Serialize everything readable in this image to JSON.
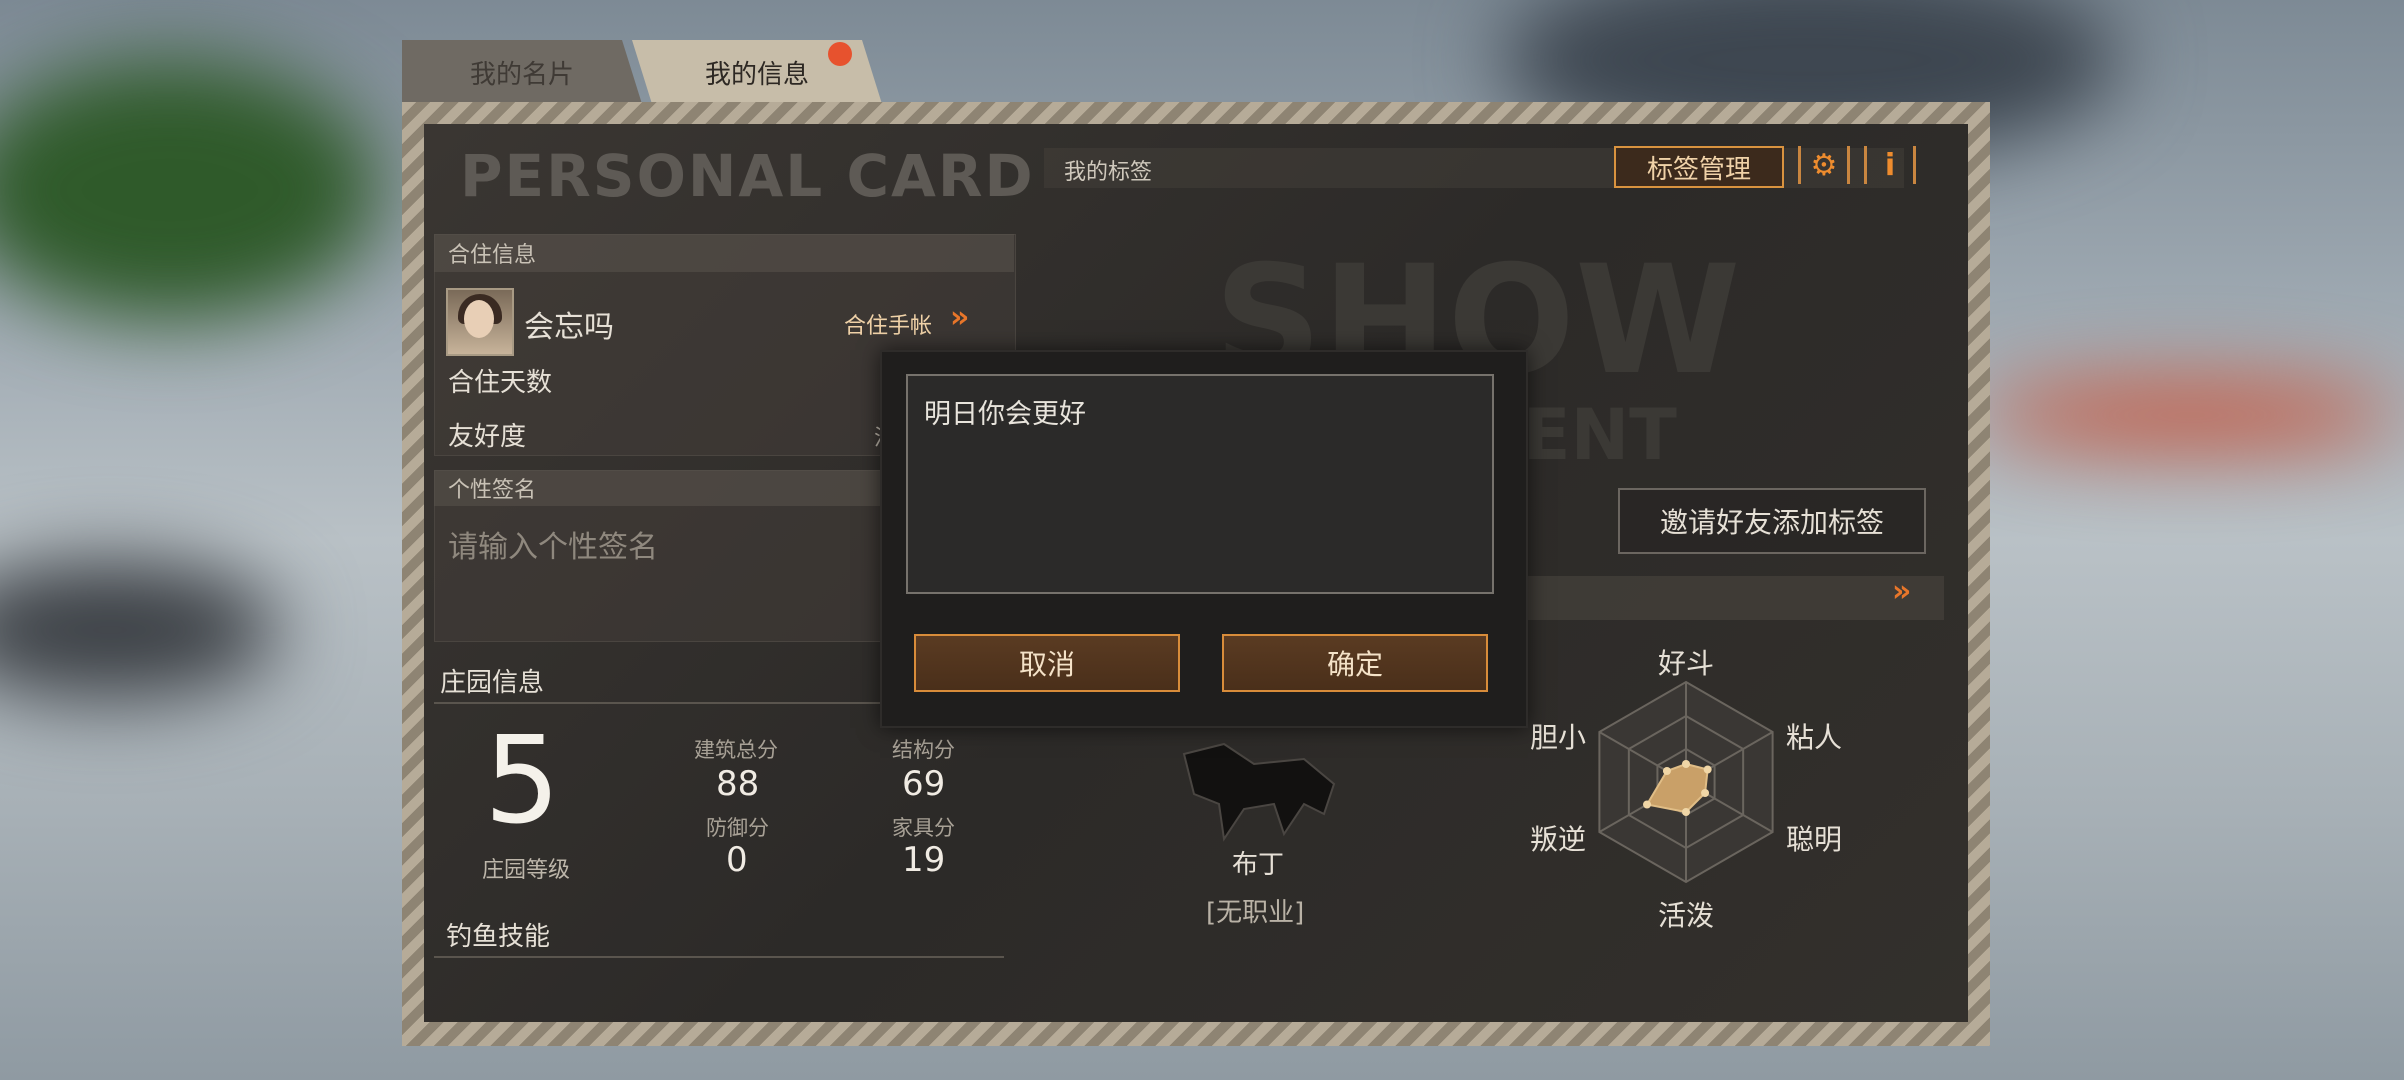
{
  "tabs": [
    {
      "label": "我的名片",
      "active": false
    },
    {
      "label": "我的信息",
      "active": true
    }
  ],
  "card": {
    "title": "PERSONAL CARD",
    "watermark_1": "SHOW",
    "watermark_2": "ALENT",
    "my_tags_label": "我的标签",
    "tag_manage_button": "标签管理",
    "settings_icon": "gear-icon",
    "info_icon_glyph": "i",
    "invite_button": "邀请好友添加标签"
  },
  "cohabit": {
    "section_label": "合住信息",
    "partner_name": "会忘吗",
    "handbook_label": "合住手帐",
    "days_label": "合住天数",
    "friendship_label": "友好度",
    "friendship_value_partial": "活"
  },
  "signature": {
    "section_label": "个性签名",
    "placeholder": "请输入个性签名"
  },
  "manor": {
    "section_label": "庄园信息",
    "level": "5",
    "level_label": "庄园等级",
    "stats": [
      {
        "label": "建筑总分",
        "value": "88"
      },
      {
        "label": "结构分",
        "value": "69"
      },
      {
        "label": "防御分",
        "value": "0"
      },
      {
        "label": "家具分",
        "value": "19"
      }
    ]
  },
  "fishing": {
    "section_label": "钓鱼技能"
  },
  "pet": {
    "name": "布丁",
    "job": "[无职业]"
  },
  "radar": {
    "labels": [
      "好斗",
      "粘人",
      "聪明",
      "活泼",
      "叛逆",
      "胆小"
    ],
    "values": [
      0.18,
      0.25,
      0.22,
      0.3,
      0.45,
      0.22
    ]
  },
  "dialog": {
    "text": "明日你会更好",
    "cancel": "取消",
    "confirm": "确定"
  },
  "colors": {
    "accent": "#e8762a",
    "panel": "#2f2c29"
  }
}
